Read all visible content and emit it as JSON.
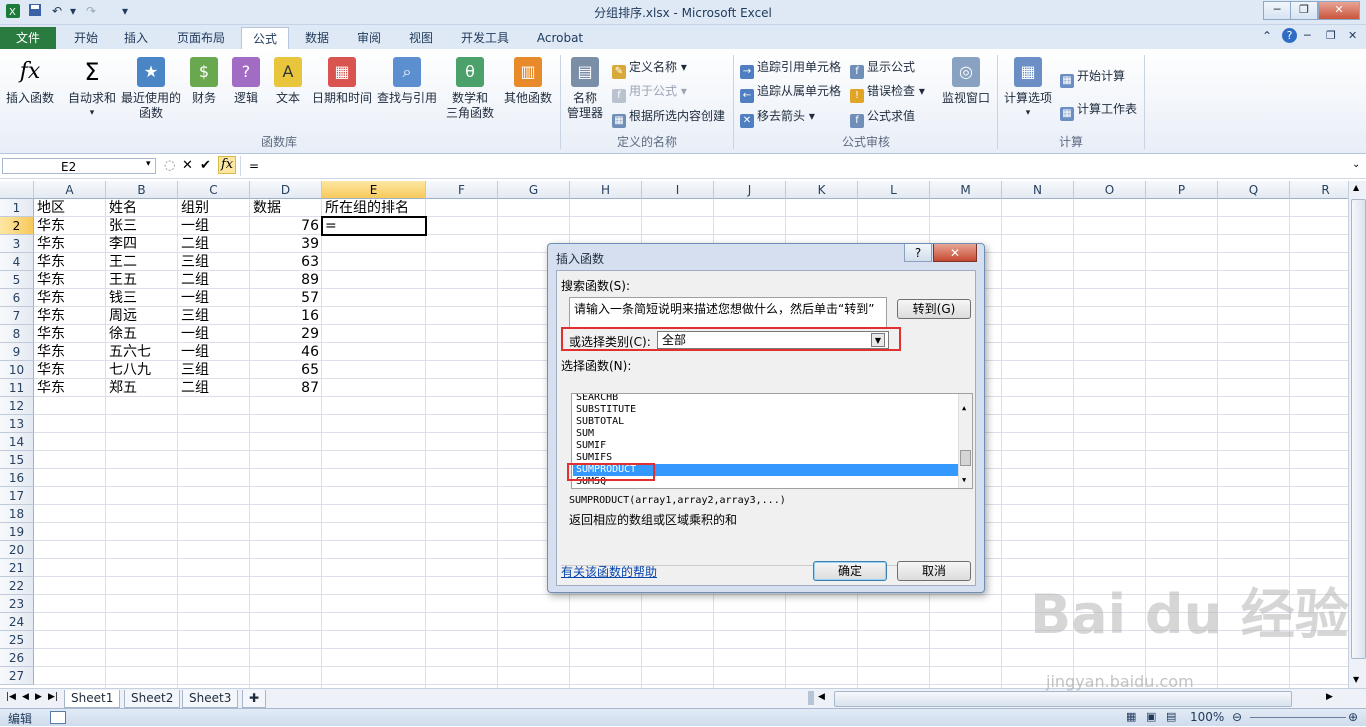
{
  "window": {
    "title": "分组排序.xlsx - Microsoft Excel"
  },
  "ribbon": {
    "tabs": [
      "文件",
      "开始",
      "插入",
      "页面布局",
      "公式",
      "数据",
      "审阅",
      "视图",
      "开发工具",
      "Acrobat"
    ],
    "function_library": {
      "group_name": "函数库",
      "insert_function": "插入函数",
      "autosum": "自动求和",
      "recent_1": "最近使用的",
      "recent_2": "函数",
      "financial": "财务",
      "logical": "逻辑",
      "text": "文本",
      "datetime": "日期和时间",
      "lookup": "查找与引用",
      "math_1": "数学和",
      "math_2": "三角函数",
      "other": "其他函数"
    },
    "defined_names": {
      "group_name": "定义的名称",
      "name_manager_1": "名称",
      "name_manager_2": "管理器",
      "define_name": "定义名称",
      "use_in_formula": "用于公式",
      "create_from_selection": "根据所选内容创建"
    },
    "formula_auditing": {
      "group_name": "公式审核",
      "trace_precedents": "追踪引用单元格",
      "trace_dependents": "追踪从属单元格",
      "remove_arrows": "移去箭头",
      "show_formulas": "显示公式",
      "error_checking": "错误检查",
      "evaluate_formula": "公式求值",
      "watch_window": "监视窗口"
    },
    "calculation": {
      "group_name": "计算",
      "calc_options": "计算选项",
      "calc_now": "开始计算",
      "calc_sheet": "计算工作表"
    }
  },
  "formula_bar": {
    "name_box": "E2",
    "formula": "="
  },
  "grid": {
    "columns": [
      "A",
      "B",
      "C",
      "D",
      "E",
      "F",
      "G",
      "H",
      "I",
      "J",
      "K",
      "L",
      "M",
      "N",
      "O",
      "P",
      "Q",
      "R"
    ],
    "rows": [
      "1",
      "2",
      "3",
      "4",
      "5",
      "6",
      "7",
      "8",
      "9",
      "10",
      "11",
      "12",
      "13",
      "14",
      "15",
      "16",
      "17",
      "18",
      "19",
      "20",
      "21",
      "22",
      "23",
      "24",
      "25",
      "26",
      "27"
    ],
    "header_row": [
      "地区",
      "姓名",
      "组别",
      "数据",
      "所在组的排名"
    ],
    "data_rows": [
      [
        "华东",
        "张三",
        "一组",
        "76",
        "="
      ],
      [
        "华东",
        "李四",
        "二组",
        "39",
        ""
      ],
      [
        "华东",
        "王二",
        "三组",
        "63",
        ""
      ],
      [
        "华东",
        "王五",
        "二组",
        "89",
        ""
      ],
      [
        "华东",
        "钱三",
        "一组",
        "57",
        ""
      ],
      [
        "华东",
        "周远",
        "三组",
        "16",
        ""
      ],
      [
        "华东",
        "徐五",
        "一组",
        "29",
        ""
      ],
      [
        "华东",
        "五六七",
        "一组",
        "46",
        ""
      ],
      [
        "华东",
        "七八九",
        "三组",
        "65",
        ""
      ],
      [
        "华东",
        "郑五",
        "二组",
        "87",
        ""
      ]
    ]
  },
  "sheets": [
    "Sheet1",
    "Sheet2",
    "Sheet3"
  ],
  "status": {
    "mode": "编辑",
    "zoom": "100%"
  },
  "dialog": {
    "title": "插入函数",
    "help_btn": "?",
    "close_btn": "✕",
    "search_label": "搜索函数(S):",
    "search_value": "请输入一条简短说明来描述您想做什么，然后单击“转到”",
    "go_button": "转到(G)",
    "category_label": "或选择类别(C):",
    "category_value": "全部",
    "select_label": "选择函数(N):",
    "functions": [
      "SEARCHB",
      "SUBSTITUTE",
      "SUBTOTAL",
      "SUM",
      "SUMIF",
      "SUMIFS",
      "SUMPRODUCT",
      "SUMSQ"
    ],
    "selected_function": "SUMPRODUCT",
    "syntax": "SUMPRODUCT(array1,array2,array3,...)",
    "description": "返回相应的数组或区域乘积的和",
    "help_link": "有关该函数的帮助",
    "ok_button": "确定",
    "cancel_button": "取消"
  },
  "watermark": {
    "brand": "Bai du 经验",
    "url": "jingyan.baidu.com"
  }
}
